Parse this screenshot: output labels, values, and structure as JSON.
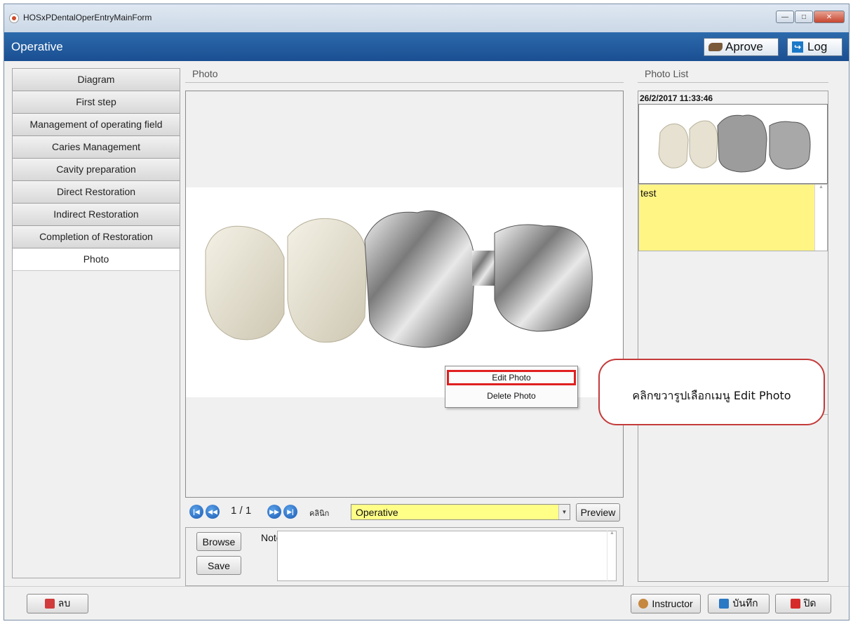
{
  "window": {
    "title": "HOSxPDentalOperEntryMainForm"
  },
  "header": {
    "title": "Operative",
    "approve_label": "Aprove",
    "log_label": "Log"
  },
  "sidebar": {
    "items": [
      {
        "label": "Diagram"
      },
      {
        "label": "First step"
      },
      {
        "label": "Management of operating field"
      },
      {
        "label": "Caries Management"
      },
      {
        "label": "Cavity preparation"
      },
      {
        "label": "Direct Restoration"
      },
      {
        "label": "Indirect Restoration"
      },
      {
        "label": "Completion of Restoration"
      },
      {
        "label": "Photo",
        "active": true
      }
    ]
  },
  "photo": {
    "section_label": "Photo",
    "page_indicator": "1 / 1",
    "clinic_label": "คลินิก",
    "clinic_value": "Operative",
    "preview_label": "Preview",
    "browse_label": "Browse",
    "save_label": "Save",
    "note_label": "Note",
    "note_value": ""
  },
  "context_menu": {
    "edit": "Edit Photo",
    "delete": "Delete Photo"
  },
  "callout": {
    "text": "คลิกขวารูปเลือกเมนู Edit Photo"
  },
  "photo_list": {
    "section_label": "Photo List",
    "date": "26/2/2017 11:33:46",
    "note": "test"
  },
  "footer": {
    "delete_label": "ลบ",
    "instructor_label": "Instructor",
    "save_label": "บันทึก",
    "close_label": "ปิด"
  },
  "icons": {
    "approve": "key-icon",
    "log": "log-icon",
    "first": "first-page-icon",
    "prev": "prev-page-icon",
    "next": "next-page-icon",
    "last": "last-page-icon",
    "delete": "trash-icon",
    "instructor": "person-icon",
    "save": "floppy-icon",
    "close": "close-icon"
  },
  "colors": {
    "header": "#1a4f92",
    "note_yellow": "#fff585",
    "clinic_yellow": "#ffff88",
    "callout_border": "#c43a3a"
  }
}
